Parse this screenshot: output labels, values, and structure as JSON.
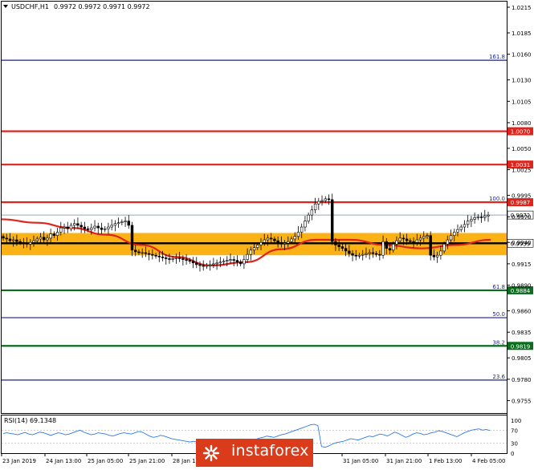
{
  "header": {
    "symbol": "USDCHF,H1",
    "ohlc": "0.9972 0.9972 0.9971 0.9972"
  },
  "rsi": {
    "label": "RSI(14) 69.1348",
    "levels": [
      "100",
      "70",
      "30",
      "0"
    ],
    "values": [
      60,
      62,
      60,
      58,
      56,
      60,
      63,
      58,
      56,
      60,
      64,
      62,
      58,
      54,
      58,
      62,
      60,
      56,
      58,
      62,
      66,
      70,
      64,
      60,
      56,
      58,
      62,
      60,
      58,
      54,
      52,
      56,
      60,
      62,
      60,
      58,
      62,
      66,
      64,
      58,
      52,
      48,
      50,
      54,
      52,
      48,
      44,
      42,
      40,
      38,
      36,
      34,
      36,
      34,
      30,
      28,
      32,
      36,
      34,
      30,
      26,
      28,
      32,
      34,
      30,
      28,
      32,
      36,
      38,
      42,
      46,
      48,
      52,
      50,
      48,
      52,
      56,
      58,
      62,
      66,
      70,
      74,
      78,
      82,
      86,
      88,
      84,
      20,
      18,
      22,
      28,
      32,
      34,
      36,
      40,
      44,
      42,
      40,
      44,
      48,
      52,
      50,
      54,
      58,
      56,
      52,
      58,
      64,
      60,
      54,
      48,
      52,
      58,
      62,
      60,
      56,
      58,
      62,
      64,
      68,
      66,
      62,
      58,
      54,
      50,
      56,
      62,
      66,
      70,
      72,
      74,
      70,
      72,
      69
    ]
  },
  "watermark": {
    "text": "instaforex"
  },
  "chart_data": {
    "type": "candlestick",
    "symbol": "USDCHF",
    "timeframe": "H1",
    "y_ticks": [
      "1.0215",
      "1.0185",
      "1.0160",
      "1.0130",
      "1.0105",
      "1.0080",
      "1.0050",
      "1.0025",
      "0.9995",
      "0.9970",
      "0.9940",
      "0.9915",
      "0.9890",
      "0.9860",
      "0.9835",
      "0.9805",
      "0.9780",
      "0.9755"
    ],
    "x_ticks": [
      "23 Jan 2019",
      "24 Jan 13:00",
      "25 Jan 05:00",
      "25 Jan 21:00",
      "28 Jan 1",
      "31 Jan 05:00",
      "31 Jan 21:00",
      "1 Feb 13:00",
      "4 Feb 05:00"
    ],
    "horizontal_lines": [
      {
        "price": 1.0153,
        "label": "161.8",
        "color": "#1b1f8f"
      },
      {
        "price": 1.007,
        "label": "1.0070",
        "color": "#e0241b"
      },
      {
        "price": 1.0031,
        "label": "1.0031",
        "color": "#e0241b"
      },
      {
        "price": 0.9987,
        "label": "0.9987",
        "fib": "100.0",
        "color": "#e0241b"
      },
      {
        "price": 0.9939,
        "label": "0.9939",
        "color": "#000000"
      },
      {
        "price": 0.9884,
        "label": "0.9884",
        "fib": "61.8",
        "color": "#0a6e1e"
      },
      {
        "price": 0.9852,
        "label": "50.0",
        "color": "#1b1f8f"
      },
      {
        "price": 0.9819,
        "label": "0.9819",
        "fib": "38.2",
        "color": "#0a6e1e"
      },
      {
        "price": 0.9779,
        "label": "23.6",
        "color": "#1b1f8f"
      }
    ],
    "current_price": 0.9972,
    "support_zone": [
      0.9925,
      0.9951
    ],
    "moving_average": [
      0.9967,
      0.9963,
      0.9957,
      0.9949,
      0.9937,
      0.9923,
      0.9913,
      0.9917,
      0.9932,
      0.9943,
      0.9943,
      0.9937,
      0.9933,
      0.9937,
      0.9943
    ],
    "closes": [
      0.9945,
      0.9944,
      0.9942,
      0.9943,
      0.9941,
      0.994,
      0.9939,
      0.9938,
      0.994,
      0.9942,
      0.9944,
      0.9946,
      0.9943,
      0.9945,
      0.995,
      0.9948,
      0.9952,
      0.9957,
      0.9958,
      0.9956,
      0.996,
      0.9962,
      0.996,
      0.9958,
      0.9956,
      0.9955,
      0.9957,
      0.9959,
      0.9957,
      0.9955,
      0.9956,
      0.9958,
      0.996,
      0.9962,
      0.9963,
      0.9964,
      0.9965,
      0.996,
      0.9931,
      0.9929,
      0.9928,
      0.9928,
      0.9927,
      0.9926,
      0.9925,
      0.9924,
      0.9923,
      0.9922,
      0.9921,
      0.992,
      0.9921,
      0.9922,
      0.9921,
      0.992,
      0.9919,
      0.9918,
      0.9916,
      0.9914,
      0.9913,
      0.9912,
      0.9913,
      0.9914,
      0.9915,
      0.9916,
      0.9917,
      0.9918,
      0.9919,
      0.992,
      0.9919,
      0.9917,
      0.9915,
      0.992,
      0.9926,
      0.9931,
      0.9934,
      0.9937,
      0.994,
      0.9943,
      0.9945,
      0.9944,
      0.9942,
      0.994,
      0.9938,
      0.9939,
      0.9941,
      0.9944,
      0.9947,
      0.9952,
      0.9958,
      0.9965,
      0.9972,
      0.9978,
      0.9985,
      0.9988,
      0.9989,
      0.9991,
      0.999,
      0.9941,
      0.9937,
      0.9935,
      0.9933,
      0.993,
      0.9927,
      0.9925,
      0.9924,
      0.9925,
      0.9926,
      0.9927,
      0.9928,
      0.9927,
      0.9926,
      0.9925,
      0.9941,
      0.9933,
      0.9931,
      0.9938,
      0.9942,
      0.9945,
      0.9944,
      0.9942,
      0.9941,
      0.994,
      0.9943,
      0.9945,
      0.9947,
      0.9948,
      0.9925,
      0.9923,
      0.9925,
      0.993,
      0.9938,
      0.9943,
      0.9948,
      0.9952,
      0.9955,
      0.9958,
      0.9961,
      0.9965,
      0.9967,
      0.9969,
      0.997,
      0.9969,
      0.9971,
      0.9972
    ]
  }
}
